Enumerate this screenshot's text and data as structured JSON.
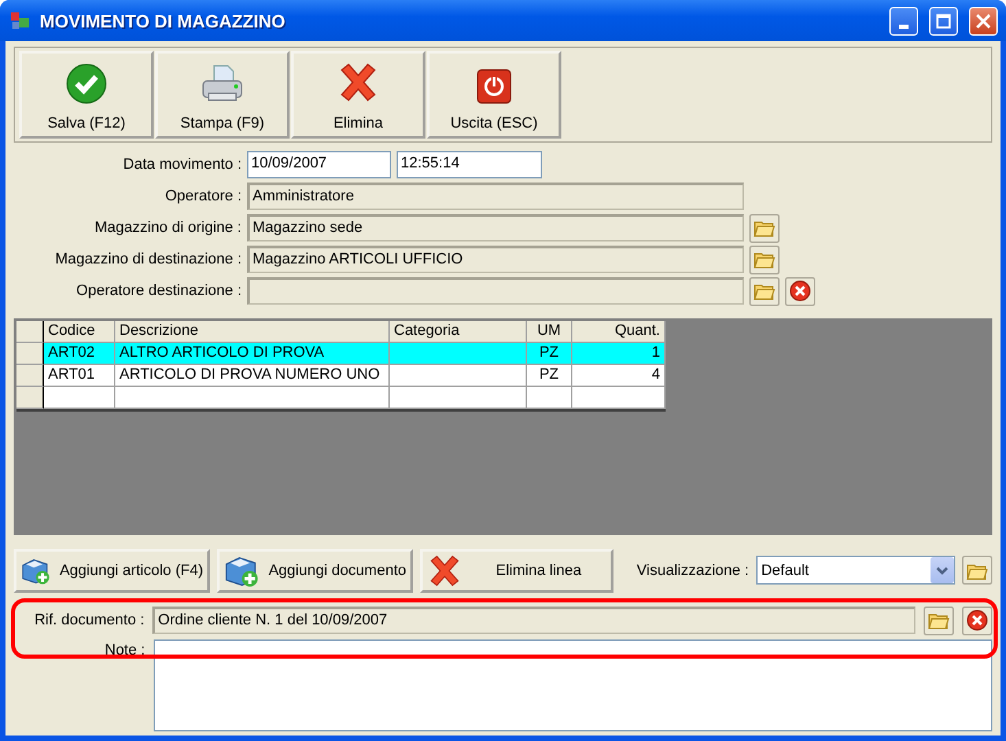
{
  "window": {
    "title": "MOVIMENTO DI MAGAZZINO"
  },
  "toolbar": [
    {
      "label": "Salva (F12)",
      "kind": "save"
    },
    {
      "label": "Stampa (F9)",
      "kind": "print"
    },
    {
      "label": "Elimina",
      "kind": "delete"
    },
    {
      "label": "Uscita (ESC)",
      "kind": "exit"
    }
  ],
  "fields": [
    {
      "label": "Data movimento :",
      "kind": "datetime",
      "date": "10/09/2007",
      "time": "12:55:14"
    },
    {
      "label": "Operatore :",
      "kind": "readonly",
      "value": "Amministratore"
    },
    {
      "label": "Magazzino di origine :",
      "kind": "readonly",
      "value": "Magazzino sede",
      "browsable": true
    },
    {
      "label": "Magazzino di destinazione :",
      "kind": "readonly",
      "value": "Magazzino ARTICOLI UFFICIO",
      "browsable": true
    },
    {
      "label": "Operatore destinazione :",
      "kind": "readonly",
      "browsable": true,
      "clearable": true
    }
  ],
  "table": {
    "columns": [
      {
        "label": "Codice",
        "kind": "text"
      },
      {
        "label": "Descrizione",
        "kind": "text"
      },
      {
        "label": "Categoria",
        "kind": "text"
      },
      {
        "label": "UM",
        "kind": "unit"
      },
      {
        "label": "Quant.",
        "kind": "number"
      }
    ],
    "rows": [
      {
        "cells": [
          "ART02",
          "ALTRO ARTICOLO DI PROVA",
          "",
          "PZ",
          "1"
        ],
        "selected": true
      },
      {
        "cells": [
          "ART01",
          "ARTICOLO DI PROVA NUMERO UNO",
          "",
          "PZ",
          "4"
        ],
        "selected": false
      }
    ]
  },
  "line_buttons": [
    {
      "label": "Aggiungi articolo (F4)",
      "kind": "add"
    },
    {
      "label": "Aggiungi documento",
      "kind": "add"
    },
    {
      "label": "Elimina linea",
      "kind": "delete"
    }
  ],
  "view": {
    "label": "Visualizzazione :",
    "value": "Default"
  },
  "reference": {
    "label": "Rif. documento :",
    "value": "Ordine cliente N. 1 del 10/09/2007",
    "highlighted": true
  },
  "notes": {
    "label": "Note :"
  }
}
